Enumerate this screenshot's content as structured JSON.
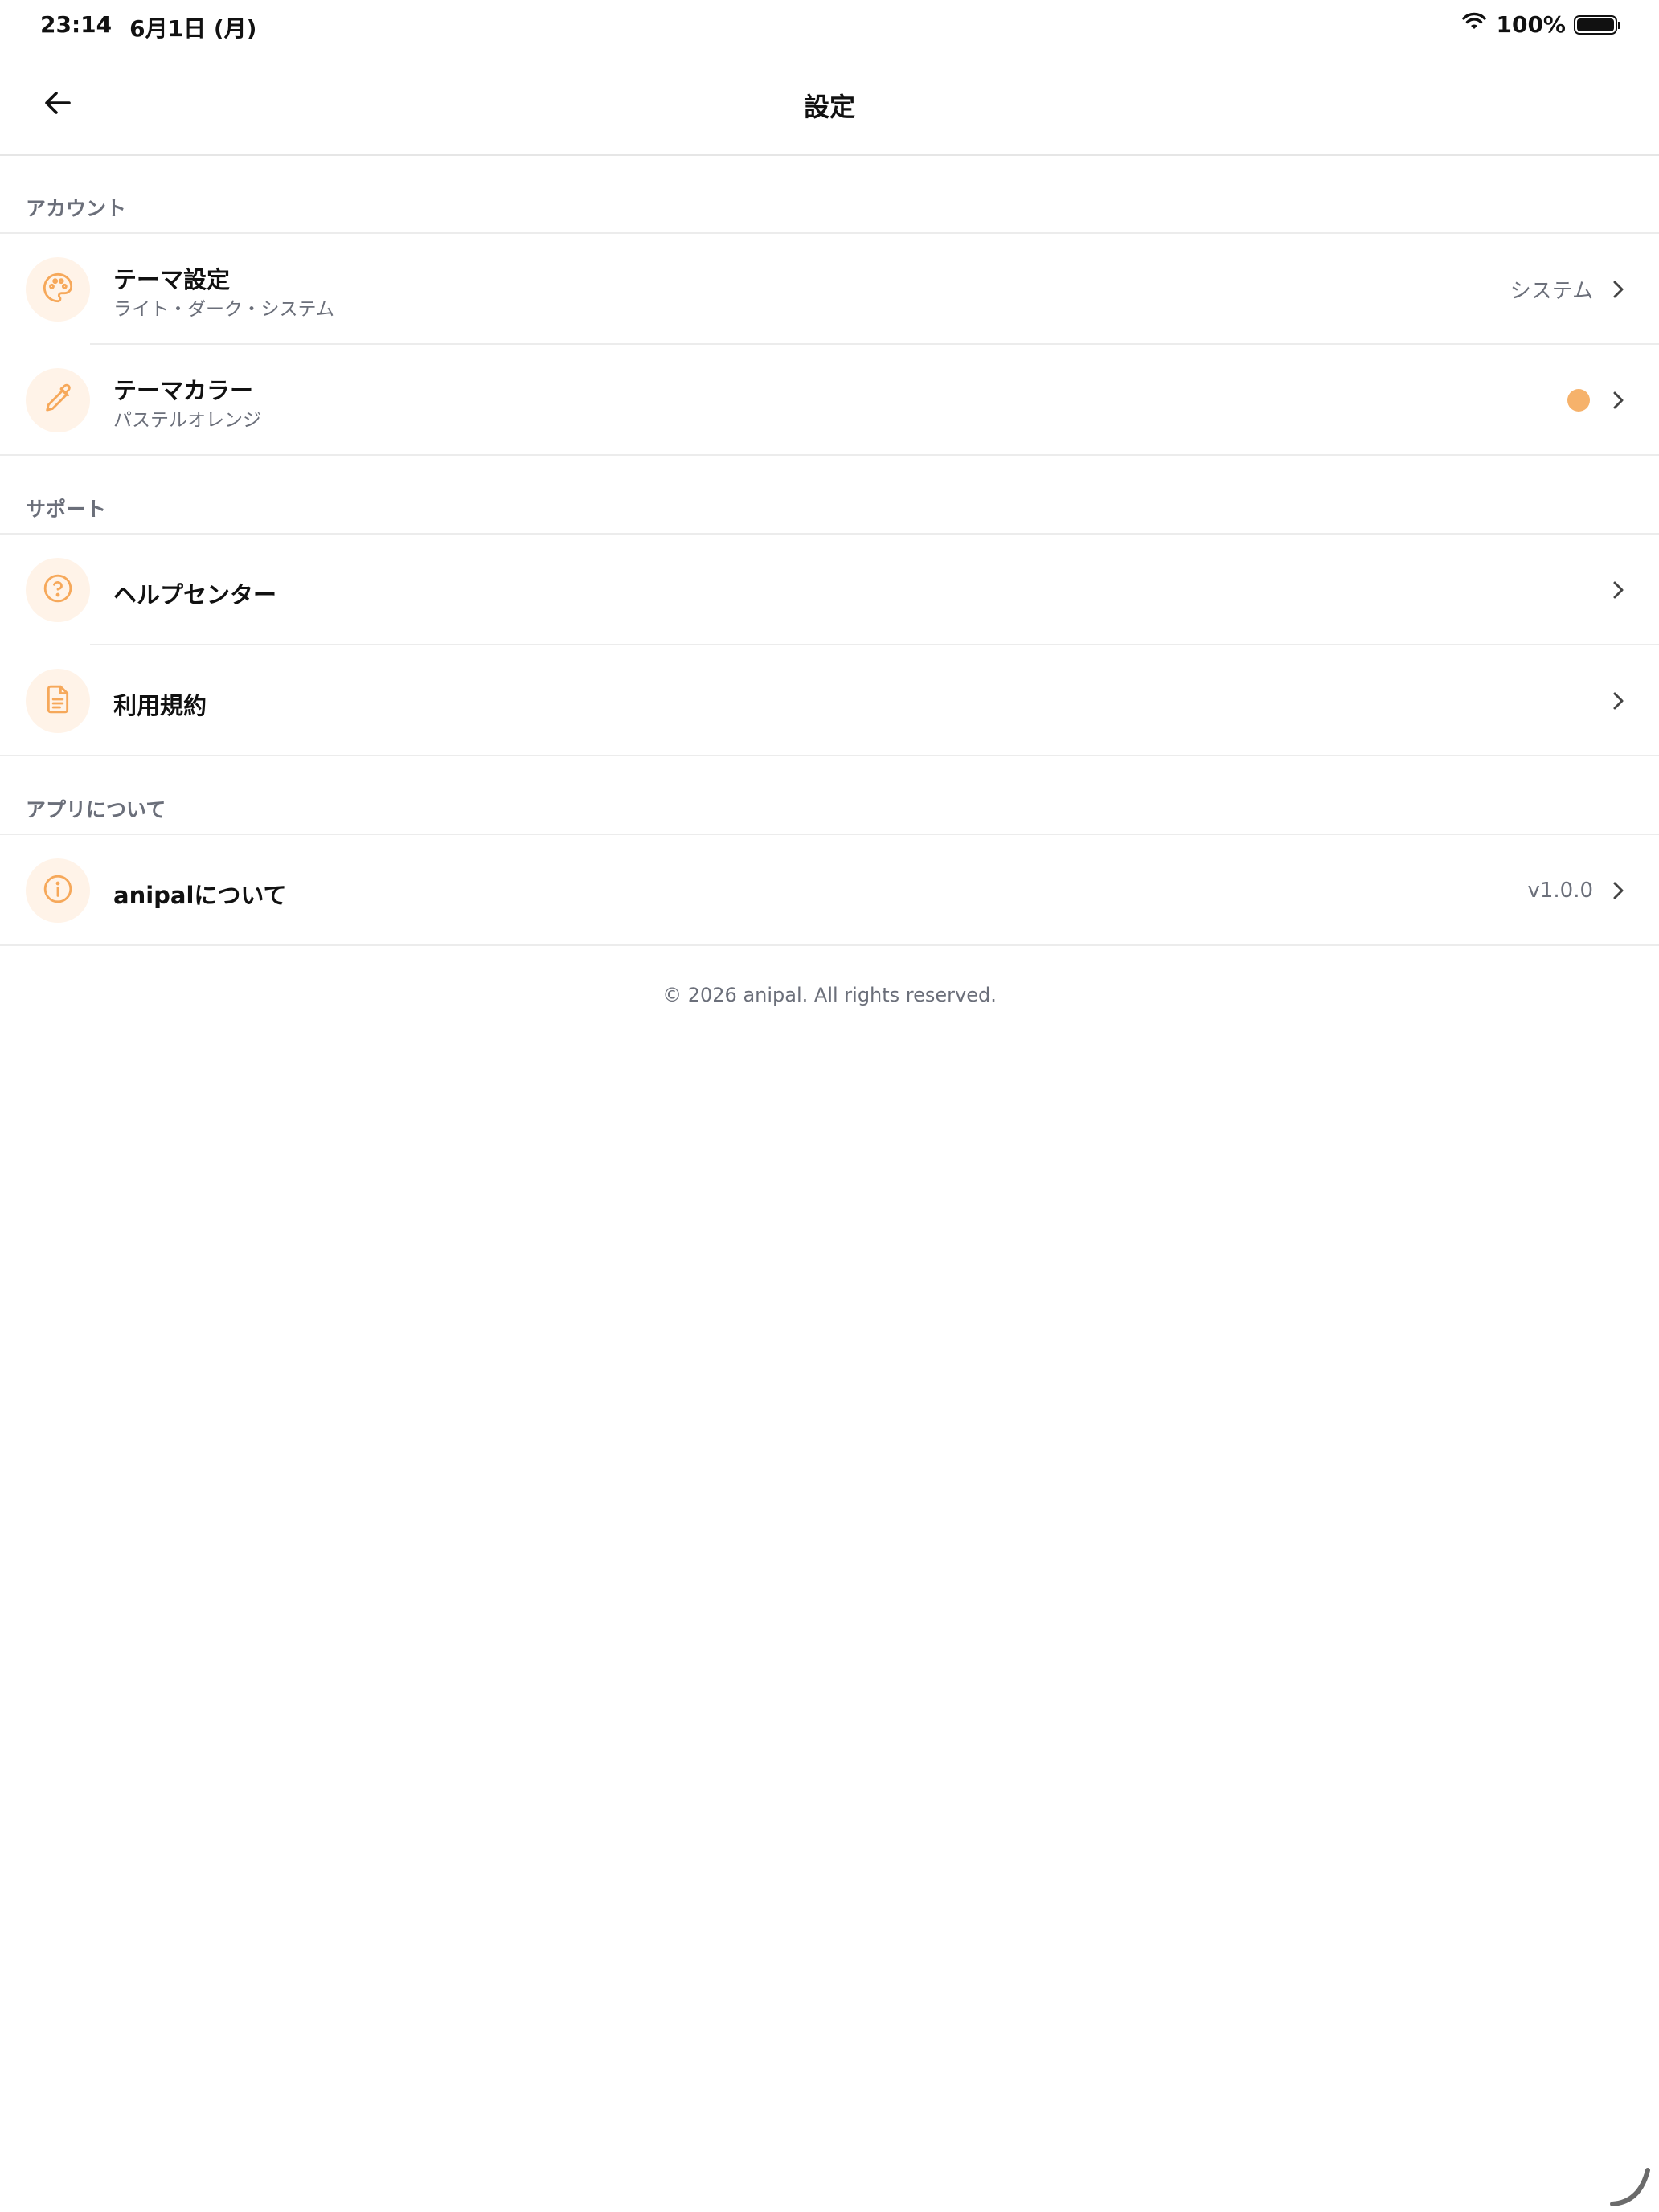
{
  "status_bar": {
    "time": "23:14",
    "date": "6月1日 (月)",
    "battery_percent": "100%"
  },
  "header": {
    "title": "設定",
    "back_icon": "arrow-left-icon"
  },
  "sections": {
    "account": {
      "label": "アカウント",
      "items": [
        {
          "title": "テーマ設定",
          "subtitle": "ライト・ダーク・システム",
          "value": "システム",
          "icon": "palette-icon"
        },
        {
          "title": "テーマカラー",
          "subtitle": "パステルオレンジ",
          "color": "#f6b26b",
          "icon": "eyedropper-icon"
        }
      ]
    },
    "support": {
      "label": "サポート",
      "items": [
        {
          "title": "ヘルプセンター",
          "icon": "help-circle-icon"
        },
        {
          "title": "利用規約",
          "icon": "document-icon"
        }
      ]
    },
    "about": {
      "label": "アプリについて",
      "items": [
        {
          "title": "anipalについて",
          "value": "v1.0.0",
          "icon": "info-circle-icon"
        }
      ]
    }
  },
  "footer": {
    "copyright": "© 2026 anipal. All rights reserved."
  },
  "colors": {
    "accent": "#f6a85a",
    "icon_bg": "#fff3e8",
    "secondary_text": "#6b6f7a",
    "divider": "#ececec"
  }
}
